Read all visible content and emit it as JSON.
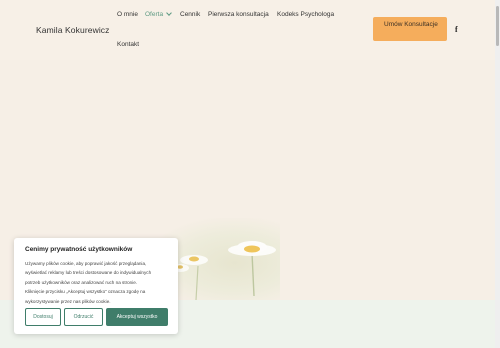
{
  "header": {
    "brand": "Kamila Kokurewicz",
    "nav": [
      "O mnie",
      "Oferta",
      "Cennik",
      "Pierwsza konsultacja",
      "Kodeks Psychologa",
      "Kontakt"
    ],
    "cta_label": "Umów Konsultacje",
    "social_icon": "facebook-icon"
  },
  "cookie_banner": {
    "title": "Cenimy prywatność użytkowników",
    "text": [
      "Używamy plików cookie, aby poprawić jakość przeglądania,",
      "wyświetlać reklamy lub treści dostosowane do indywidualnych",
      "potrzeb użytkowników oraz analizować ruch na stronie.",
      "Kliknięcie przycisku „Akceptuj wszystko” oznacza zgodę na",
      "wykorzystywanie przez nas plików cookie."
    ],
    "buttons": {
      "customize": "Dostosuj",
      "reject": "Odrzucić",
      "accept": "Akceptuj wszystko"
    }
  },
  "colors": {
    "page_background": "#f6efe6",
    "accent_green": "#3f7d6a",
    "active_nav": "#5e9a83",
    "cta_orange": "#f5ad5c"
  }
}
